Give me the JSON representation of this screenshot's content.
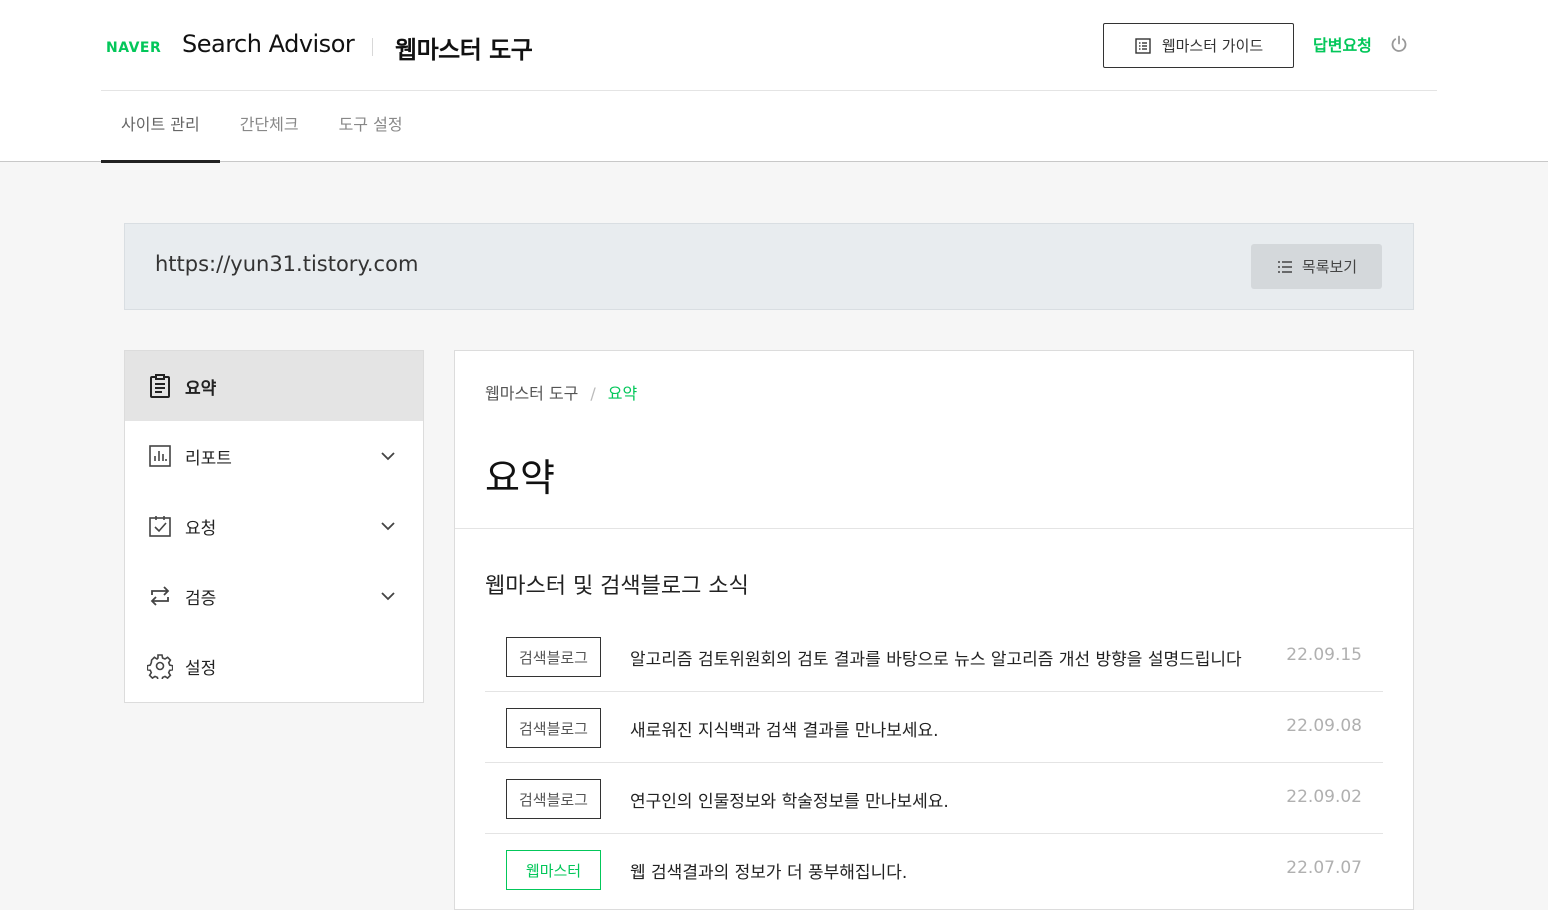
{
  "header": {
    "logo_naver": "NAVER",
    "logo_title": "Search Advisor",
    "tool_title": "웹마스터 도구",
    "guide_button": "웹마스터 가이드",
    "answer_request": "답변요청"
  },
  "tabs": [
    {
      "label": "사이트 관리",
      "active": true
    },
    {
      "label": "간단체크",
      "active": false
    },
    {
      "label": "도구 설정",
      "active": false
    }
  ],
  "site": {
    "url": "https://yun31.tistory.com",
    "list_button": "목록보기"
  },
  "sidebar": {
    "items": [
      {
        "label": "요약",
        "icon": "clipboard-icon",
        "active": true
      },
      {
        "label": "리포트",
        "icon": "bar-chart-icon",
        "expandable": true
      },
      {
        "label": "요청",
        "icon": "checklist-icon",
        "expandable": true
      },
      {
        "label": "검증",
        "icon": "repeat-icon",
        "expandable": true
      },
      {
        "label": "설정",
        "icon": "gear-icon"
      }
    ]
  },
  "main": {
    "breadcrumb": {
      "parent": "웹마스터 도구",
      "separator": "/",
      "current": "요약"
    },
    "title": "요약",
    "news_section_title": "웹마스터 및 검색블로그 소식",
    "news": [
      {
        "tag": "검색블로그",
        "title": "알고리즘 검토위원회의 검토 결과를 바탕으로 뉴스 알고리즘 개선 방향을 설명드립니다",
        "date": "22.09.15",
        "tag_color": "dark"
      },
      {
        "tag": "검색블로그",
        "title": "새로워진 지식백과 검색 결과를 만나보세요.",
        "date": "22.09.08",
        "tag_color": "dark"
      },
      {
        "tag": "검색블로그",
        "title": "연구인의 인물정보와 학술정보를 만나보세요.",
        "date": "22.09.02",
        "tag_color": "dark"
      },
      {
        "tag": "웹마스터",
        "title": "웹 검색결과의 정보가 더 풍부해집니다.",
        "date": "22.07.07",
        "tag_color": "green"
      }
    ]
  },
  "colors": {
    "brand": "#03c75a",
    "text": "#222222",
    "muted": "#b0b0b0"
  }
}
